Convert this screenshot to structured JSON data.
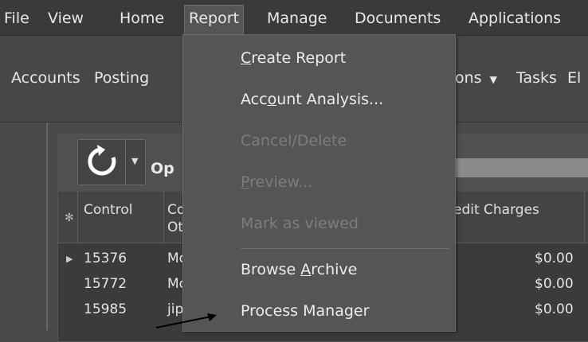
{
  "menubar": {
    "items": [
      "File",
      "View",
      "Home",
      "Report",
      "Manage",
      "Documents",
      "Applications"
    ]
  },
  "toolbar": {
    "items": [
      "Accounts",
      "Posting",
      "ons",
      "Tasks",
      "El"
    ]
  },
  "panel": {
    "label": "Op",
    "columns": {
      "star": "✻",
      "control": "Control",
      "c_line1": "Co",
      "c_line2": "Ot",
      "charges": "edit Charges"
    },
    "rows": [
      {
        "control": "15376",
        "col2": "Mo",
        "charges": "$0.00"
      },
      {
        "control": "15772",
        "col2": "Mo",
        "charges": "$0.00"
      },
      {
        "control": "15985",
        "col2": "jip",
        "charges": "$0.00"
      }
    ]
  },
  "report_menu": {
    "create_report": {
      "pre": "",
      "key": "C",
      "post": "reate Report"
    },
    "account_analysis": {
      "pre": "Acc",
      "key": "o",
      "post": "unt Analysis..."
    },
    "cancel_delete": "Cancel/Delete",
    "preview": {
      "pre": "",
      "key": "P",
      "post": "review..."
    },
    "mark_viewed": "Mark as viewed",
    "browse_archive": {
      "pre": "Browse ",
      "key": "A",
      "post": "rchive"
    },
    "process_manager": "Process Manager"
  }
}
